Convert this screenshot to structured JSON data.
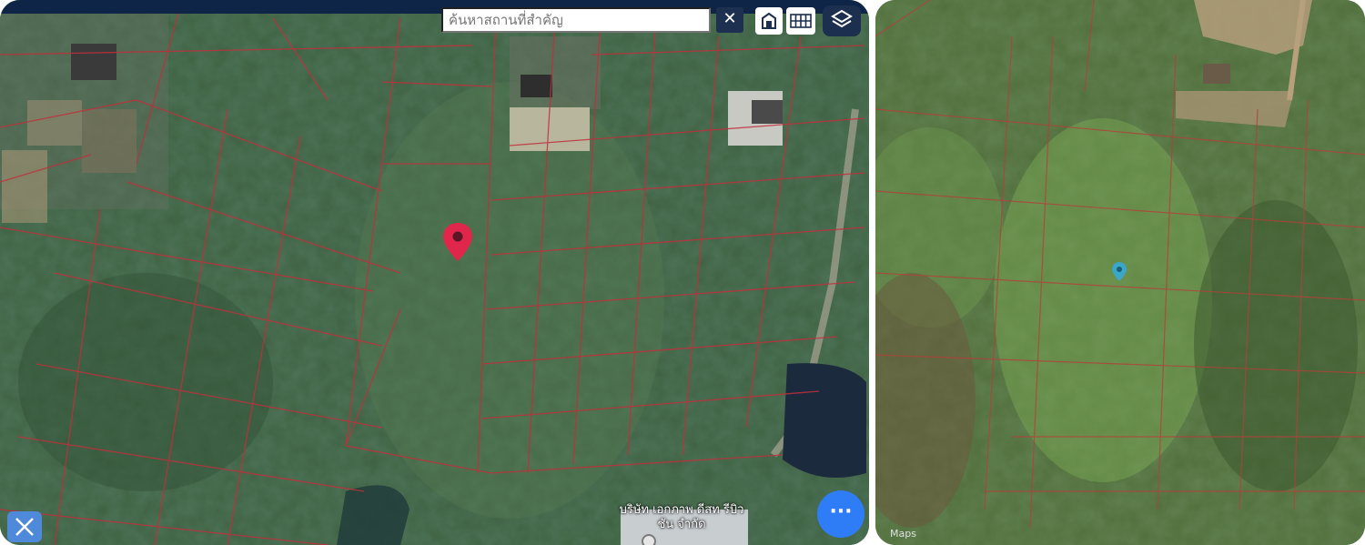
{
  "left_map": {
    "search": {
      "placeholder": "ค้นหาสถานที่สำคัญ",
      "clear_icon": "close-icon"
    },
    "top_buttons": [
      {
        "icon": "place-icon"
      },
      {
        "icon": "grid-icon"
      },
      {
        "icon": "layers-icon"
      }
    ],
    "company_label": "บริษัท เอกภาพ ดีสท รีบิวชัน จำกัด",
    "fab": {
      "label": "···",
      "icon": "more-icon"
    },
    "tool": {
      "icon": "measure-tool-icon"
    },
    "marker": {
      "icon": "location-pin-icon",
      "color": "#e0264a"
    },
    "colors": {
      "topbar": "#0f2547",
      "parcel_lines": "#c0303d",
      "fab": "#2f7df6"
    }
  },
  "right_map": {
    "attribution": "Maps",
    "marker": {
      "icon": "location-pin-icon",
      "color": "#3aa6c8"
    },
    "colors": {
      "parcel_lines": "#b2413a"
    }
  }
}
